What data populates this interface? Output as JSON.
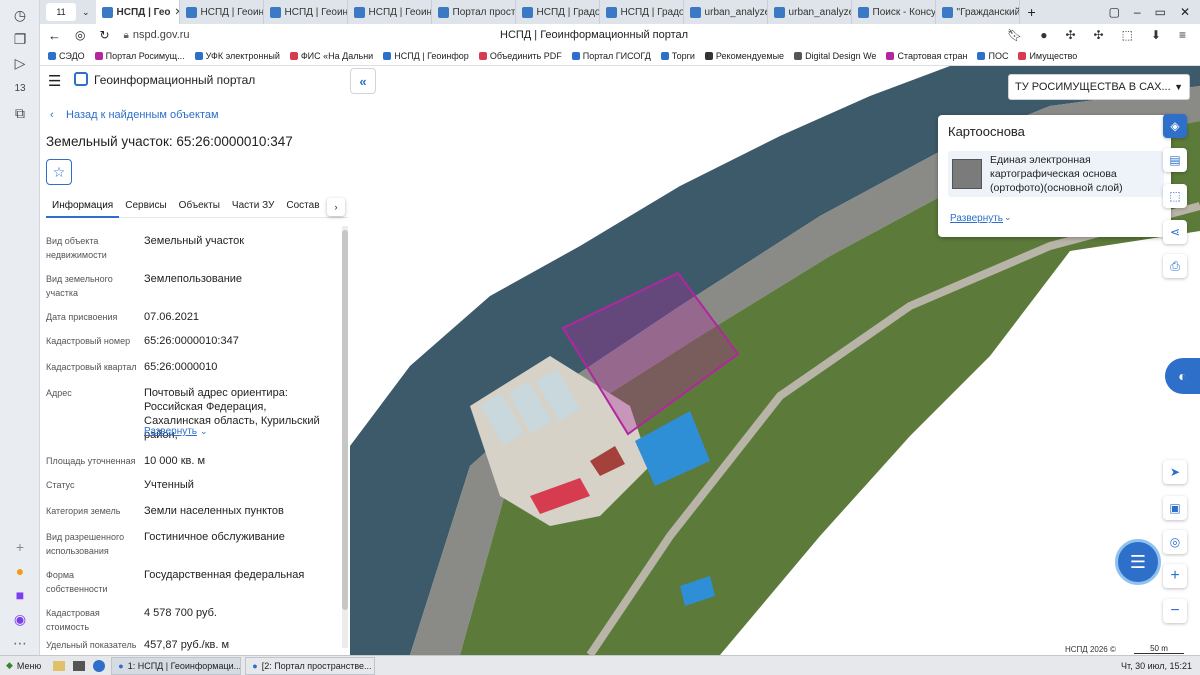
{
  "browser": {
    "tab_count": "11",
    "tabs": [
      {
        "title": "НСПД | Гео",
        "active": true
      },
      {
        "title": "НСПД | Геоинф"
      },
      {
        "title": "НСПД | Геоинф"
      },
      {
        "title": "НСПД | Геоин"
      },
      {
        "title": "Портал прост"
      },
      {
        "title": "НСПД | Градо"
      },
      {
        "title": "НСПД | Градо"
      },
      {
        "title": "urban_analyze"
      },
      {
        "title": "urban_analyze"
      },
      {
        "title": "Поиск - Консу"
      },
      {
        "title": "\"Гражданский"
      }
    ],
    "url": "nspd.gov.ru",
    "page_title": "НСПД | Геоинформационный портал",
    "bookmarks": [
      "СЭДО",
      "Портал Росимущ...",
      "УФК электронный",
      "ФИС «На Дальни",
      "НСПД | Геоинфор",
      "Объединить PDF",
      "Портал ГИСОГД",
      "Торги",
      "Рекомендуемые",
      "Digital Design We",
      "Стартовая стран",
      "ПОС",
      "Имущество"
    ]
  },
  "app": {
    "logo_text": "Геоинформационный портал",
    "back_link": "Назад к найденным объектам",
    "object_title": "Земельный участок: 65:26:0000010:347",
    "tabs": [
      "Информация",
      "Сервисы",
      "Объекты",
      "Части ЗУ",
      "Состав"
    ],
    "fields": [
      {
        "label": "Вид объекта недвижимости",
        "value": "Земельный участок"
      },
      {
        "label": "Вид земельного участка",
        "value": "Землепользование"
      },
      {
        "label": "Дата присвоения",
        "value": "07.06.2021"
      },
      {
        "label": "Кадастровый номер",
        "value": "65:26:0000010:347"
      },
      {
        "label": "Кадастровый квартал",
        "value": "65:26:0000010"
      },
      {
        "label": "Адрес",
        "value": "Почтовый адрес ориентира: Российская Федерация, Сахалинская область, Курильский район,"
      },
      {
        "label": "Площадь уточненная",
        "value": "10 000 кв. м"
      },
      {
        "label": "Статус",
        "value": "Учтенный"
      },
      {
        "label": "Категория земель",
        "value": "Земли населенных пунктов"
      },
      {
        "label": "Вид разрешенного использования",
        "value": "Гостиничное обслуживание"
      },
      {
        "label": "Форма собственности",
        "value": "Государственная федеральная"
      },
      {
        "label": "Кадастровая стоимость",
        "value": "4 578 700 руб."
      },
      {
        "label": "Удельный показатель",
        "value": "457,87 руб./кв. м"
      }
    ],
    "expand_link": "Развернуть"
  },
  "map": {
    "org_select": "ТУ РОСИМУЩЕСТВА В САХ...",
    "basemap": {
      "title": "Картооснова",
      "layer": "Единая электронная картографическая основа (ортофото)(основной слой)",
      "expand": "Развернуть"
    },
    "copyright": "НСПД 2026 ©",
    "scale": "50 m"
  },
  "taskbar": {
    "menu": "Меню",
    "items": [
      "1: НСПД | Геоинформаци...",
      "[2: Портал пространстве..."
    ],
    "clock": "Чт, 30 июл, 15:21"
  },
  "colors": {
    "accent": "#2d6fc9",
    "parcel": "#b0279e"
  }
}
